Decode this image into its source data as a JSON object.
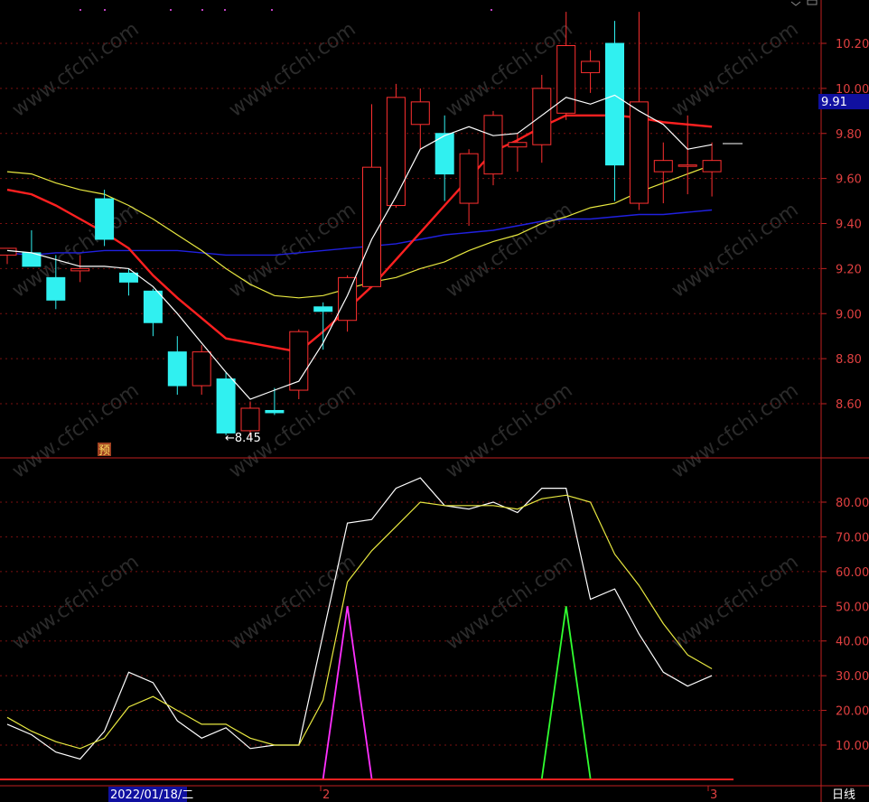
{
  "chart_data": [
    {
      "type": "candlestick",
      "period_label": "日线",
      "date_marker": "2022/01/18/二",
      "month_marks": [
        "2",
        "3"
      ],
      "forecast_tag": "预",
      "low_note": "←8.45",
      "current_price": "9.91",
      "ylim": [
        8.45,
        10.35
      ],
      "yticks": [
        "10.20",
        "10.00",
        "9.80",
        "9.60",
        "9.40",
        "9.20",
        "9.00",
        "8.80",
        "8.60"
      ],
      "candles": [
        {
          "o": 9.26,
          "h": 9.29,
          "l": 9.22,
          "c": 9.29
        },
        {
          "o": 9.27,
          "h": 9.37,
          "l": 9.24,
          "c": 9.21
        },
        {
          "o": 9.16,
          "h": 9.26,
          "l": 9.02,
          "c": 9.06
        },
        {
          "o": 9.19,
          "h": 9.26,
          "l": 9.14,
          "c": 9.2
        },
        {
          "o": 9.51,
          "h": 9.55,
          "l": 9.3,
          "c": 9.33
        },
        {
          "o": 9.18,
          "h": 9.2,
          "l": 9.08,
          "c": 9.14
        },
        {
          "o": 9.1,
          "h": 9.11,
          "l": 8.9,
          "c": 8.96
        },
        {
          "o": 8.83,
          "h": 8.9,
          "l": 8.64,
          "c": 8.68
        },
        {
          "o": 8.68,
          "h": 8.86,
          "l": 8.64,
          "c": 8.83
        },
        {
          "o": 8.71,
          "h": 8.74,
          "l": 8.46,
          "c": 8.47
        },
        {
          "o": 8.48,
          "h": 8.61,
          "l": 8.45,
          "c": 8.58
        },
        {
          "o": 8.57,
          "h": 8.67,
          "l": 8.55,
          "c": 8.56
        },
        {
          "o": 8.66,
          "h": 8.93,
          "l": 8.62,
          "c": 8.92
        },
        {
          "o": 9.03,
          "h": 9.05,
          "l": 8.84,
          "c": 9.01
        },
        {
          "o": 8.97,
          "h": 9.17,
          "l": 8.92,
          "c": 9.16
        },
        {
          "o": 9.12,
          "h": 9.93,
          "l": 9.12,
          "c": 9.65
        },
        {
          "o": 9.48,
          "h": 10.02,
          "l": 9.47,
          "c": 9.96
        },
        {
          "o": 9.84,
          "h": 10.0,
          "l": 9.73,
          "c": 9.94
        },
        {
          "o": 9.8,
          "h": 9.88,
          "l": 9.5,
          "c": 9.62
        },
        {
          "o": 9.49,
          "h": 9.73,
          "l": 9.39,
          "c": 9.71
        },
        {
          "o": 9.62,
          "h": 9.9,
          "l": 9.57,
          "c": 9.88
        },
        {
          "o": 9.74,
          "h": 9.8,
          "l": 9.63,
          "c": 9.76
        },
        {
          "o": 9.75,
          "h": 10.06,
          "l": 9.67,
          "c": 10.0
        },
        {
          "o": 9.89,
          "h": 10.34,
          "l": 9.86,
          "c": 10.19
        },
        {
          "o": 10.07,
          "h": 10.17,
          "l": 9.98,
          "c": 10.12
        },
        {
          "o": 10.2,
          "h": 10.3,
          "l": 9.5,
          "c": 9.66
        },
        {
          "o": 9.49,
          "h": 10.34,
          "l": 9.46,
          "c": 9.94
        },
        {
          "o": 9.63,
          "h": 9.76,
          "l": 9.49,
          "c": 9.68
        },
        {
          "o": 9.66,
          "h": 9.88,
          "l": 9.53,
          "c": 9.66
        },
        {
          "o": 9.63,
          "h": 9.76,
          "l": 9.52,
          "c": 9.68
        }
      ],
      "ma_white": [
        9.28,
        9.27,
        9.24,
        9.21,
        9.21,
        9.2,
        9.12,
        9.0,
        8.87,
        8.74,
        8.62,
        8.66,
        8.7,
        8.87,
        9.08,
        9.33,
        9.52,
        9.73,
        9.79,
        9.83,
        9.79,
        9.8,
        9.88,
        9.96,
        9.93,
        9.97,
        9.9,
        9.84,
        9.73,
        9.75
      ],
      "ma_red": [
        9.55,
        9.53,
        9.48,
        9.42,
        9.36,
        9.29,
        9.17,
        9.07,
        8.98,
        8.89,
        8.87,
        8.85,
        8.83,
        8.92,
        9.02,
        9.12,
        9.24,
        9.36,
        9.48,
        9.6,
        9.72,
        9.77,
        9.83,
        9.88,
        9.88,
        9.88,
        9.87,
        9.85,
        9.84,
        9.83
      ],
      "ma_yellow": [
        9.63,
        9.62,
        9.58,
        9.55,
        9.53,
        9.48,
        9.42,
        9.35,
        9.28,
        9.2,
        9.13,
        9.08,
        9.07,
        9.08,
        9.11,
        9.14,
        9.16,
        9.2,
        9.23,
        9.28,
        9.32,
        9.35,
        9.4,
        9.43,
        9.47,
        9.49,
        9.54,
        9.58,
        9.62,
        9.66
      ],
      "ma_blue": [
        9.27,
        9.26,
        9.27,
        9.27,
        9.28,
        9.28,
        9.28,
        9.28,
        9.27,
        9.26,
        9.26,
        9.26,
        9.27,
        9.28,
        9.29,
        9.3,
        9.31,
        9.33,
        9.35,
        9.36,
        9.37,
        9.39,
        9.41,
        9.42,
        9.42,
        9.43,
        9.44,
        9.44,
        9.45,
        9.46
      ],
      "grid": true
    },
    {
      "type": "line",
      "ylim": [
        0,
        92
      ],
      "yticks": [
        "80.00",
        "70.00",
        "60.00",
        "50.00",
        "40.00",
        "30.00",
        "20.00",
        "10.00"
      ],
      "series": [
        {
          "color": "#ffffff",
          "values": [
            16,
            13,
            8,
            6,
            14,
            31,
            28,
            17,
            12,
            15,
            9,
            10,
            10,
            42,
            74,
            75,
            84,
            87,
            79,
            78,
            80,
            77,
            84,
            84,
            52,
            55,
            42,
            31,
            27,
            30
          ]
        },
        {
          "color": "#e8e840",
          "values": [
            18,
            14,
            11,
            9,
            12,
            21,
            24,
            20,
            16,
            16,
            12,
            10,
            10,
            23,
            57,
            66,
            73,
            80,
            79,
            79,
            79,
            78,
            81,
            82,
            80,
            65,
            56,
            45,
            36,
            32
          ]
        }
      ],
      "signals": [
        {
          "index": 14,
          "height": 50,
          "color": "#ff30ff"
        },
        {
          "index": 23,
          "height": 50,
          "color": "#30ff30"
        }
      ]
    }
  ]
}
